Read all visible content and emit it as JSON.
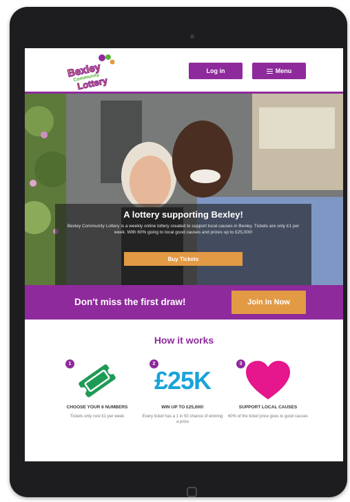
{
  "header": {
    "logo_lines": [
      "Bexley",
      "Community",
      "Lottery"
    ],
    "login_label": "Log in",
    "menu_label": "Menu"
  },
  "hero": {
    "title": "A lottery supporting Bexley!",
    "text": "Bexley Community Lottery is a weekly online lottery created to support local causes in Bexley. Tickets are only £1 per week. With 60% going to local good causes and prizes up to £25,000!",
    "cta_label": "Buy Tickets"
  },
  "banner": {
    "text": "Don't miss the first draw!",
    "cta_label": "Join In Now"
  },
  "how_it_works": {
    "title": "How it works",
    "steps": [
      {
        "number": "1",
        "icon": "ticket-icon",
        "heading": "CHOOSE YOUR 6 NUMBERS",
        "desc": "Tickets only cost £1 per week"
      },
      {
        "number": "2",
        "icon": "prize-text",
        "big": "£25K",
        "heading": "WIN UP TO £25,000!",
        "desc": "Every ticket has a 1 in 50 chance of winning a prize"
      },
      {
        "number": "3",
        "icon": "heart-icon",
        "heading": "SUPPORT LOCAL CAUSES",
        "desc": "60% of the ticket price goes to good causes"
      }
    ]
  },
  "colors": {
    "brand_purple": "#8e2a9b",
    "accent_orange": "#e39a45",
    "ticket_green": "#1e9b55",
    "prize_blue": "#1aa3d9",
    "heart_pink": "#e6168c"
  }
}
